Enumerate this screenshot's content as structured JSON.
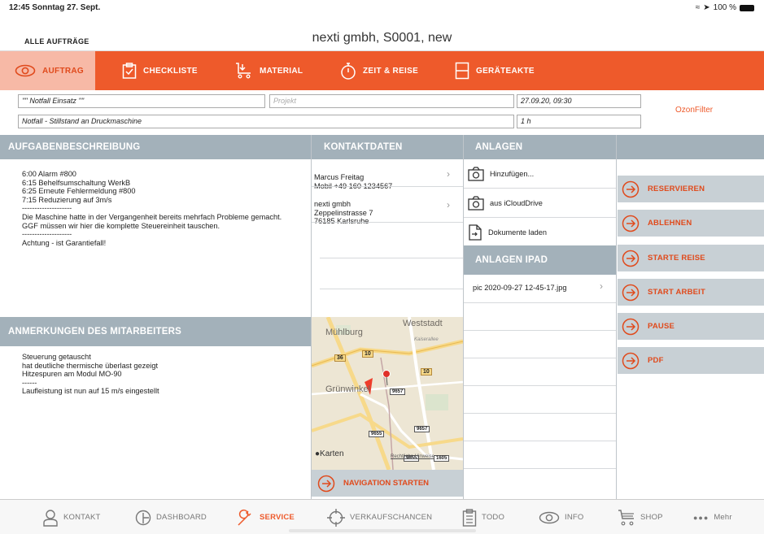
{
  "status_bar": {
    "time_date": "12:45  Sonntag 27. Sept.",
    "battery": "100 %"
  },
  "header": {
    "back_label": "ALLE AUFTRÄGE",
    "title": "nexti gmbh, S0001, new"
  },
  "tabs": [
    {
      "label": "AUFTRAG",
      "icon": "eye-icon",
      "active": true
    },
    {
      "label": "CHECKLISTE",
      "icon": "checklist-icon"
    },
    {
      "label": "MATERIAL",
      "icon": "cart-icon"
    },
    {
      "label": "ZEIT & REISE",
      "icon": "stopwatch-icon"
    },
    {
      "label": "GERÄTEAKTE",
      "icon": "file-icon"
    }
  ],
  "form": {
    "name": "'''' Notfall Einsatz ''''",
    "projekt_placeholder": "Projekt",
    "datetime": "27.09.20, 09:30",
    "description": "Notfall - Stillstand an Druckmaschine",
    "duration": "1 h",
    "filter_label": "OzonFilter"
  },
  "sections": {
    "aufgaben": "AUFGABENBESCHREIBUNG",
    "kontakt": "KONTAKTDATEN",
    "anlagen": "ANLAGEN",
    "anlagen_ipad": "ANLAGEN IPAD",
    "anmerkungen": "ANMERKUNGEN DES MITARBEITERS"
  },
  "aufgaben_text": "6:00 Alarm #800\n6:15 Behelfsumschaltung WerkB\n6:25 Erneute Fehlermeldung #800\n7:15 Reduzierung auf 3m/s\n--------------------\nDie Maschine hatte in der Vergangenheit bereits mehrfach Probleme gemacht.\nGGF müssen wir hier die komplette Steuereinheit tauschen.\n--------------------\nAchtung - ist Garantiefall!",
  "anmerkungen_text": "Steuerung getauscht\nhat deutliche thermische überlast gezeigt\nHitzespuren am Modul MO-90\n------\nLaufleistung ist nun auf 15 m/s eingestellt",
  "kontakte": [
    {
      "text": "Marcus Freitag\nMobil +49 160 1234567"
    },
    {
      "text": "nexti gmbh\nZeppelinstrasse 7\n76185 Karlsruhe"
    }
  ],
  "map": {
    "labels": {
      "weststadt": "Weststadt",
      "muehlburg": "Mühlburg",
      "kaiserallee": "Kaiserallee",
      "gruenwinkel": "Grünwinkel",
      "karten": "Karten",
      "rechtliche": "Rechtliche Hinweise"
    },
    "road_badges": [
      "36",
      "10",
      "10",
      "9657",
      "9657",
      "9655",
      "9655",
      "1605"
    ]
  },
  "navigation_button": "NAVIGATION STARTEN",
  "anlagen": [
    {
      "label": "Hinzufügen...",
      "icon": "camera-icon"
    },
    {
      "label": "aus iCloudDrive",
      "icon": "camera-icon"
    },
    {
      "label": "Dokumente laden",
      "icon": "document-icon"
    }
  ],
  "anlagen_ipad": [
    {
      "label": "pic 2020-09-27 12-45-17.jpg"
    }
  ],
  "actions": [
    "RESERVIEREN",
    "ABLEHNEN",
    "STARTE REISE",
    "START ARBEIT",
    "PAUSE",
    "PDF"
  ],
  "bottom_tabs": [
    {
      "label": "KONTAKT",
      "icon": "person-icon"
    },
    {
      "label": "DASHBOARD",
      "icon": "dashboard-icon"
    },
    {
      "label": "SERVICE",
      "icon": "wrench-icon",
      "active": true
    },
    {
      "label": "VERKAUFSCHANCEN",
      "icon": "crosshair-icon"
    },
    {
      "label": "TODO",
      "icon": "clipboard-icon"
    },
    {
      "label": "INFO",
      "icon": "eye-icon"
    },
    {
      "label": "SHOP",
      "icon": "cart-icon"
    },
    {
      "label": "Mehr",
      "icon": "more-icon"
    }
  ],
  "colors": {
    "accent": "#ee5a2b",
    "section_header": "#a3b1ba",
    "action_bg": "#c8d0d5"
  }
}
